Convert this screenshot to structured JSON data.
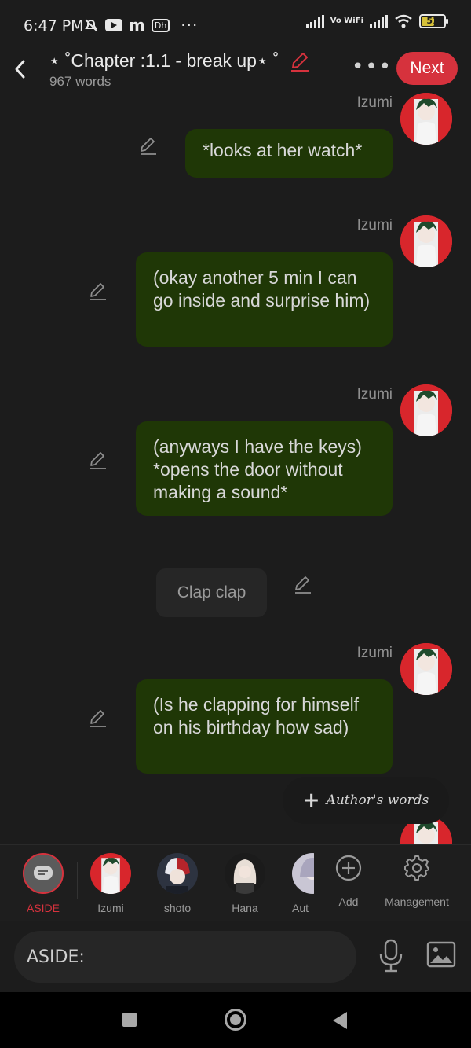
{
  "status_bar": {
    "time": "6:47 PM",
    "network_label": "Vo WiFi",
    "battery": "51",
    "icons": [
      "mute-icon",
      "youtube-icon",
      "m-app-icon",
      "dh-app-icon",
      "more-dots-icon",
      "signal-icon",
      "wifi-icon",
      "battery-icon"
    ]
  },
  "header": {
    "title": "⋆ ˚Chapter :1.1 - break up⋆ ˚",
    "word_count": "967 words",
    "next_label": "Next",
    "accent_color": "#d6323d"
  },
  "messages": [
    {
      "speaker": "Izumi",
      "text": "*looks at her watch*"
    },
    {
      "speaker": "Izumi",
      "text": "(okay another 5 min I can go inside and surprise him)"
    },
    {
      "speaker": "Izumi",
      "text": "(anyways I have the keys) *opens the door without making a sound*"
    },
    {
      "speaker": "",
      "text": "Clap clap"
    },
    {
      "speaker": "Izumi",
      "text": "(Is he clapping for himself on his birthday how sad)"
    },
    {
      "speaker": "Izumi",
      "text": ""
    }
  ],
  "authors_words": {
    "label": "Author's words"
  },
  "bubble_color": "#1f3706",
  "characters": [
    {
      "label": "ASIDE"
    },
    {
      "label": "Izumi"
    },
    {
      "label": "shoto"
    },
    {
      "label": "Hana"
    },
    {
      "label": "Aut"
    }
  ],
  "tools": [
    {
      "label": "Add",
      "icon": "plus-circle-icon"
    },
    {
      "label": "Management",
      "icon": "gear-icon"
    }
  ],
  "input": {
    "value": "ASIDE:"
  },
  "nav": {
    "icons": [
      "recents-icon",
      "home-icon",
      "back-icon"
    ]
  }
}
